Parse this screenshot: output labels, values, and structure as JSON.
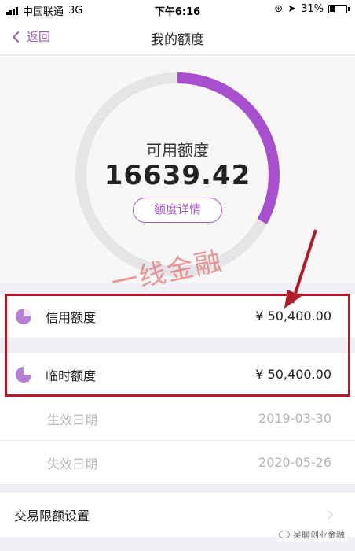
{
  "status_bar": {
    "carrier": "中国联通",
    "network": "3G",
    "time": "下午6:16",
    "battery": "31%"
  },
  "nav": {
    "back_label": "返回",
    "title": "我的额度"
  },
  "quota": {
    "available_label": "可用额度",
    "available_value": "16639.42",
    "detail_button": "额度详情",
    "ring_progress_fraction": 0.33,
    "ring_color": "#a84fd0",
    "ring_track_color": "#e5e5e8"
  },
  "rows": [
    {
      "label": "信用额度",
      "value": "¥ 50,400.00",
      "icon": "pie-chart-icon"
    },
    {
      "label": "临时额度",
      "value": "¥ 50,400.00",
      "icon": "pie-slice-icon"
    }
  ],
  "dates": [
    {
      "label": "生效日期",
      "value": "2019-03-30"
    },
    {
      "label": "失效日期",
      "value": "2020-05-26"
    }
  ],
  "settings": {
    "label": "交易限额设置"
  },
  "watermark": {
    "text": "一线金融",
    "footer": "吴聊创业金融"
  },
  "colors": {
    "accent": "#9b4fbf",
    "highlight_box": "#b01c2a"
  }
}
